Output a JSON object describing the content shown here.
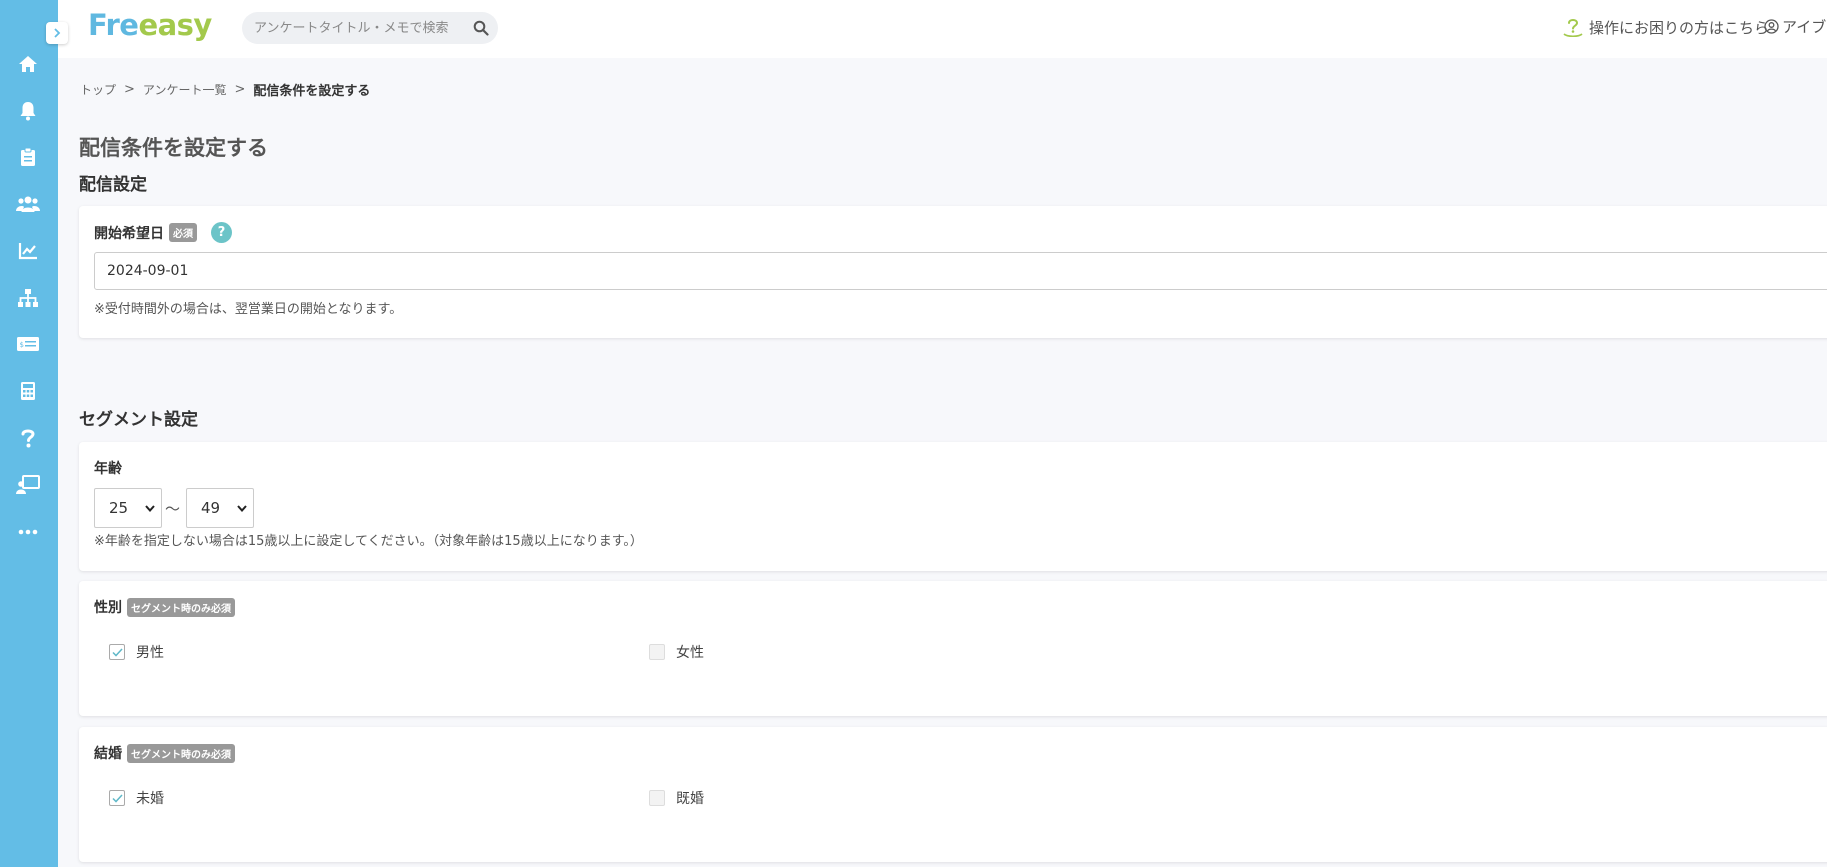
{
  "header": {
    "logo_part1": "Fre",
    "logo_part2": "easy",
    "search_placeholder": "アンケートタイトル・メモで検索",
    "help_text": "操作にお困りの方はこちら",
    "user_text": "アイブ"
  },
  "sidebar": {
    "icons": [
      "home-icon",
      "bell-icon",
      "clipboard-icon",
      "users-icon",
      "chart-icon",
      "sitemap-icon",
      "price-card-icon",
      "calculator-icon",
      "question-icon",
      "presentation-icon",
      "more-icon"
    ]
  },
  "breadcrumb": {
    "top": "トップ",
    "list": "アンケート一覧",
    "current": "配信条件を設定する",
    "sep": ">"
  },
  "page": {
    "title": "配信条件を設定する"
  },
  "delivery": {
    "section_title": "配信設定",
    "start_date_label": "開始希望日",
    "required_badge": "必須",
    "help_glyph": "?",
    "start_date_value": "2024-09-01",
    "start_date_note": "※受付時間外の場合は、翌営業日の開始となります。"
  },
  "segment": {
    "section_title": "セグメント設定",
    "age": {
      "label": "年齢",
      "from": "25",
      "to": "49",
      "tilde": "～",
      "note": "※年齢を指定しない場合は15歳以上に設定してください。（対象年齢は15歳以上になります。）"
    },
    "gender": {
      "label": "性別",
      "badge": "セグメント時のみ必須",
      "options": [
        {
          "label": "男性",
          "checked": true
        },
        {
          "label": "女性",
          "checked": false
        }
      ]
    },
    "marriage": {
      "label": "結婚",
      "badge": "セグメント時のみ必須",
      "options": [
        {
          "label": "未婚",
          "checked": true
        },
        {
          "label": "既婚",
          "checked": false
        }
      ]
    }
  },
  "colors": {
    "sidebar": "#63bde6",
    "logo_blue": "#5fb8e0",
    "logo_green": "#a3c94c",
    "help_circle": "#6cc4c8"
  }
}
